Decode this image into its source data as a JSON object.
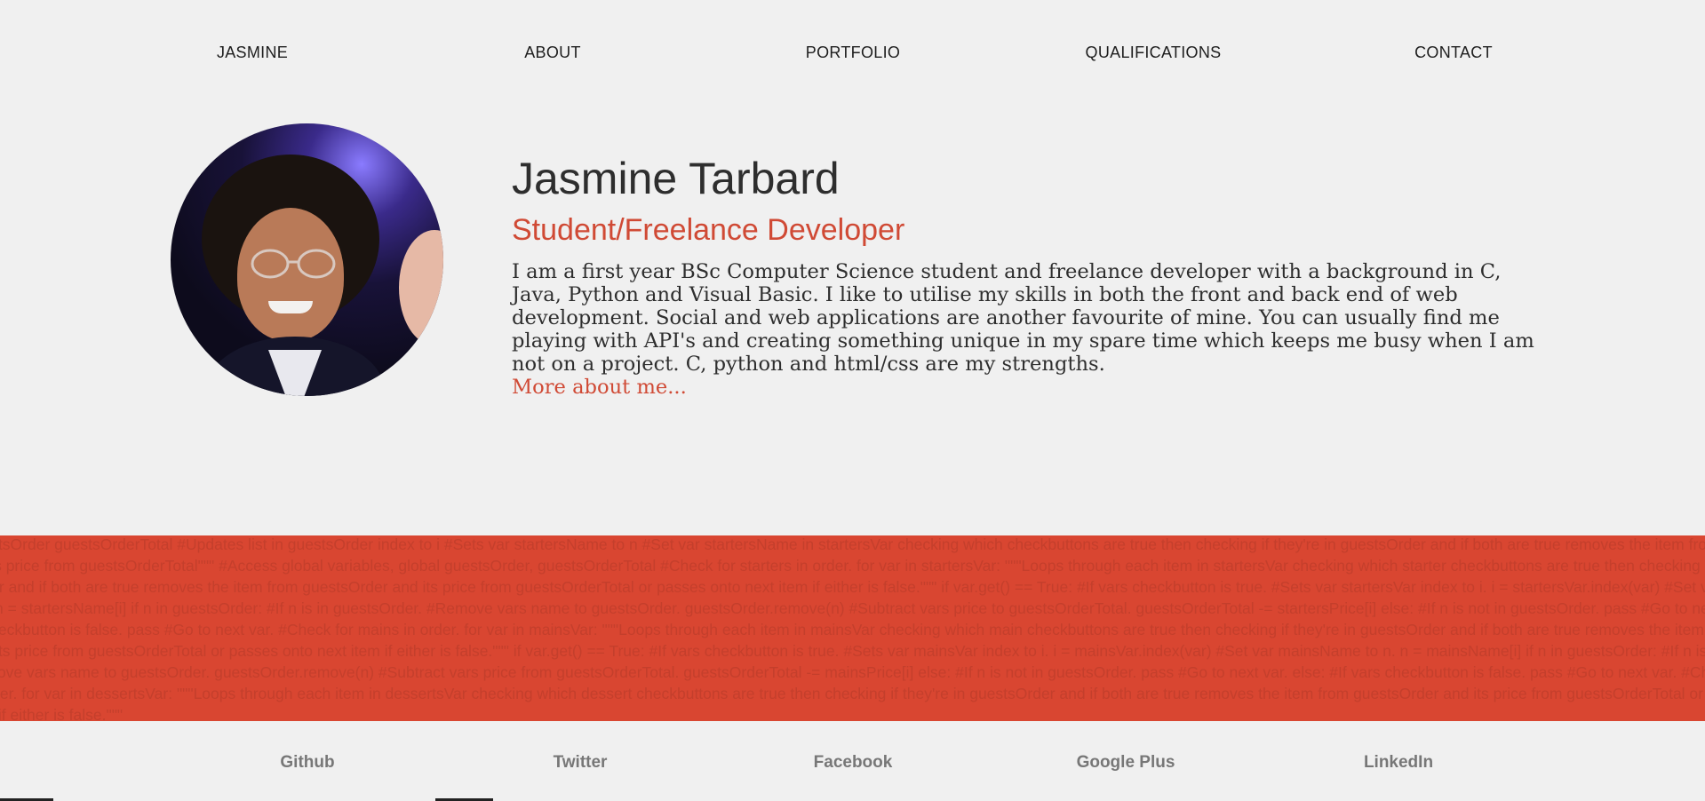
{
  "nav": {
    "brand": "JASMINE",
    "items": [
      "ABOUT",
      "PORTFOLIO",
      "QUALIFICATIONS",
      "CONTACT"
    ]
  },
  "profile": {
    "name": "Jasmine Tarbard",
    "role": "Student/Freelance Developer",
    "bio": "I am a first year BSc Computer Science student and freelance developer with a background in C, Java, Python and Visual Basic. I like to utilise my skills in both the front and back end of web development. Social and web applications are another favourite of mine. You can usually find me playing with API's and creating something unique in my spare time which keeps me busy when I am not on a project. C, python and html/css are my strengths.",
    "more_link": "More about me..."
  },
  "band": {
    "code_text": "guestsOrder guestsOrderTotal #Updates list in guestsOrder index to i #Sets var startersName to n #Set var startersName in startersVar checking which checkbuttons are true then checking if they're in guestsOrder and if both are true removes the item from guestsOrder and its price from guestsOrderTotal\"\"\" #Access global variables, global guestsOrder, guestsOrderTotal #Check for starters in order. for var in startersVar: \"\"\"Loops through each item in startersVar checking which starter checkbuttons are true then checking if they're in guestsOrder and if both are true removes the item from guestsOrder and its price from guestsOrderTotal or passes onto next item if either is false.\"\"\" if var.get() == True: #If vars checkbutton is true. #Sets var startersVar index to i. i = startersVar.index(var) #Set var startersName to n. n = startersName[i] if n in guestsOrder: #If n is in guestsOrder. #Remove vars name to guestsOrder. guestsOrder.remove(n) #Subtract vars price to guestsOrderTotal. guestsOrderTotal -= startersPrice[i] else: #If n is not in guestsOrder. pass #Go to next var. else: #If vars checkbutton is false. pass #Go to next var. #Check for mains in order. for var in mainsVar: \"\"\"Loops through each item in mainsVar checking which main checkbuttons are true then checking if they're in guestsOrder and if both are true removes the item from guestsOrder and its price from guestsOrderTotal or passes onto next item if either is false.\"\"\" if var.get() == True: #If vars checkbutton is true. #Sets var mainsVar index to i. i = mainsVar.index(var) #Set var mainsName to n. n = mainsName[i] if n in guestsOrder: #If n is in guestsOrder. #Remove vars name to guestsOrder. guestsOrder.remove(n) #Subtract vars price from guestsOrderTotal. guestsOrderTotal -= mainsPrice[i] else: #If n is not in guestsOrder. pass #Go to next var. else: #If vars checkbutton is false. pass #Go to next var. #Check for desserts in order. for var in dessertsVar: \"\"\"Loops through each item in dessertsVar checking which dessert checkbuttons are true then checking if they're in guestsOrder and if both are true removes the item from guestsOrder and its price from guestsOrderTotal or passes onto next item if either is false.\"\"\""
  },
  "footer": {
    "links": [
      "Github",
      "Twitter",
      "Facebook",
      "Google Plus",
      "LinkedIn"
    ]
  },
  "colors": {
    "accent": "#d04a35",
    "band": "#d94631",
    "background": "#f0f0f0",
    "text": "#2e2e2e",
    "footer_link": "#777777"
  },
  "icons": {
    "avatar": "profile-photo"
  }
}
